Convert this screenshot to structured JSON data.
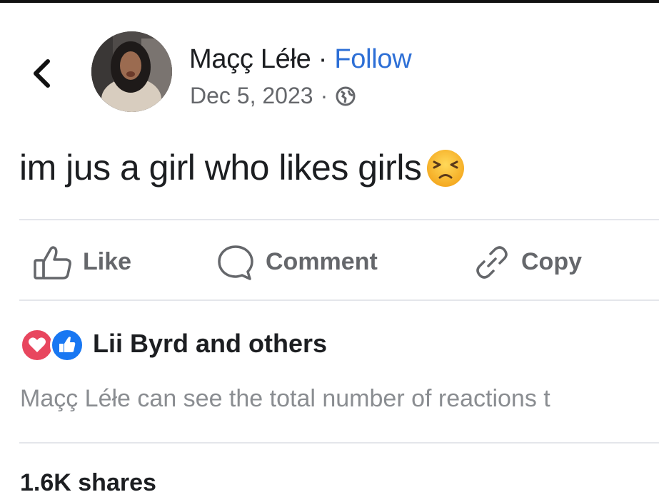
{
  "post": {
    "author_name": "Maçç Léłe",
    "separator": " · ",
    "follow_label": "Follow",
    "date": "Dec 5, 2023",
    "meta_separator": "·",
    "audience_icon": "globe-icon",
    "text": "im jus a girl who likes girls",
    "emoji": "persevering-face-emoji"
  },
  "actions": {
    "like_label": "Like",
    "comment_label": "Comment",
    "copy_label": "Copy"
  },
  "reactions": {
    "icons": [
      "love-reaction-icon",
      "like-reaction-icon"
    ],
    "summary": "Lii Byrd and others",
    "info": "Maçç Léłe can see the total number of reactions t"
  },
  "shares": "1.6K shares",
  "colors": {
    "follow": "#2d6fd6",
    "secondary_text": "#65676b",
    "love": "#e8465e",
    "like": "#1877f2",
    "divider": "#e4e6eb"
  }
}
